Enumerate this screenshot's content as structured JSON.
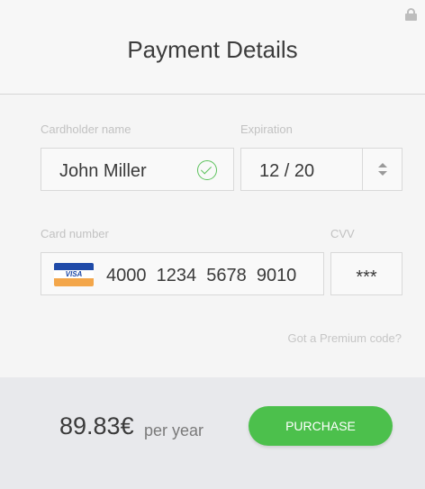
{
  "header": {
    "title": "Payment Details",
    "lock_icon": "lock-icon"
  },
  "form": {
    "cardholder": {
      "label": "Cardholder name",
      "value": "John Miller",
      "valid_icon": "check-circle-icon",
      "valid_color": "#5cc25c"
    },
    "expiration": {
      "label": "Expiration",
      "value": "12 / 20",
      "stepper_icon": "up-down-arrows-icon"
    },
    "card_number": {
      "label": "Card number",
      "value": "4000  1234  5678  9010",
      "brand_icon": "visa-card-icon",
      "brand_text": "VISA"
    },
    "cvv": {
      "label": "CVV",
      "value": "***"
    },
    "promo_link": "Got a Premium code?"
  },
  "footer": {
    "price": "89.83€",
    "period": "per year",
    "purchase_label": "PURCHASE",
    "accent_color": "#4cc04c"
  }
}
